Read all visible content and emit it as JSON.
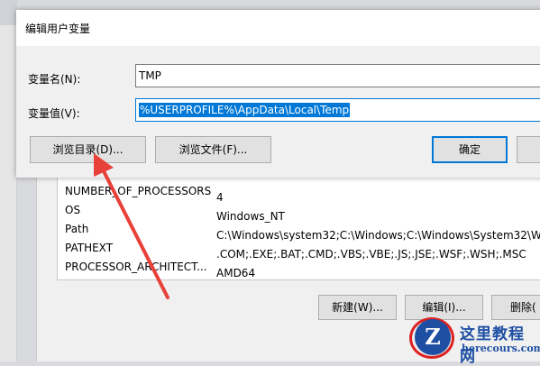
{
  "dialog": {
    "title": "编辑用户变量",
    "name_label": "变量名(N):",
    "name_value": "TMP",
    "value_label": "变量值(V):",
    "value_value": "%USERPROFILE%\\AppData\\Local\\Temp",
    "browse_dir_button": "浏览目录(D)...",
    "browse_file_button": "浏览文件(F)...",
    "ok_button": "确定"
  },
  "system_vars": {
    "rows": [
      {
        "name": "NUMBER_OF_PROCESSORS",
        "value": "4"
      },
      {
        "name": "OS",
        "value": "Windows_NT"
      },
      {
        "name": "Path",
        "value": "C:\\Windows\\system32;C:\\Windows;C:\\Windows\\System32\\Wb..."
      },
      {
        "name": "PATHEXT",
        "value": ".COM;.EXE;.BAT;.CMD;.VBS;.VBE;.JS;.JSE;.WSF;.WSH;.MSC"
      },
      {
        "name": "PROCESSOR_ARCHITECT...",
        "value": "AMD64"
      }
    ],
    "new_button": "新建(W)...",
    "edit_button": "编辑(I)...",
    "delete_button": "删除("
  },
  "watermark": {
    "logo_letter": "Z",
    "title": "这里教程网",
    "url": "herecours.com"
  },
  "colors": {
    "accent": "#0078d7",
    "arrow": "#e8413a"
  }
}
